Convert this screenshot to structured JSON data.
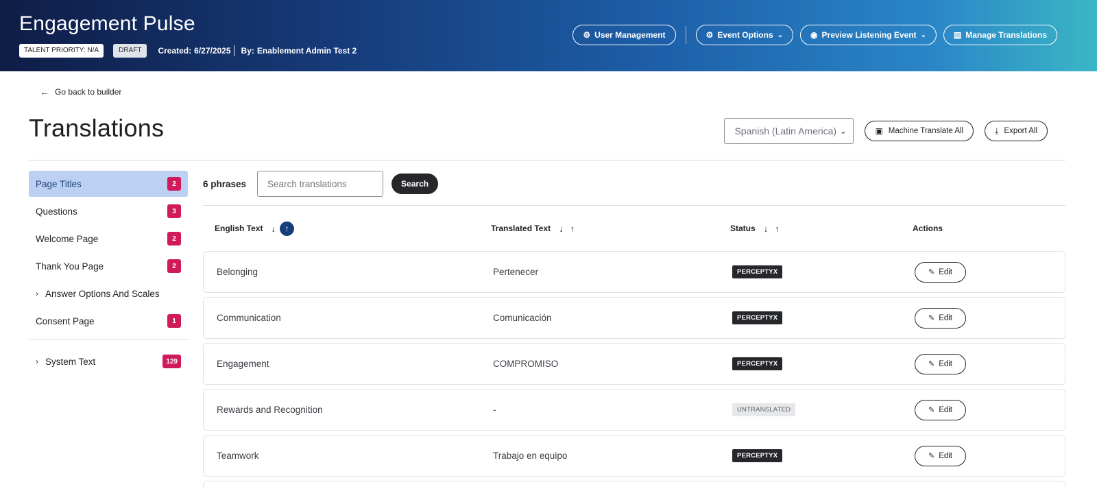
{
  "header": {
    "title": "Engagement Pulse",
    "talent_priority": "TALENT PRIORITY: N/A",
    "draft_label": "DRAFT",
    "created_label": "Created:",
    "created_value": "6/27/2025",
    "by_label": "By:",
    "by_value": "Enablement Admin Test 2",
    "actions": {
      "user_management": "User Management",
      "event_options": "Event Options",
      "preview_event": "Preview Listening Event",
      "manage_translations": "Manage Translations"
    }
  },
  "back_link": "Go back to builder",
  "page_title": "Translations",
  "controls": {
    "language_selected": "Spanish (Latin America)",
    "machine_translate": "Machine Translate All",
    "export_all": "Export All"
  },
  "sidebar": {
    "items": [
      {
        "label": "Page Titles",
        "count": "2"
      },
      {
        "label": "Questions",
        "count": "3"
      },
      {
        "label": "Welcome Page",
        "count": "2"
      },
      {
        "label": "Thank You Page",
        "count": "2"
      },
      {
        "label": "Answer Options And Scales"
      },
      {
        "label": "Consent Page",
        "count": "1"
      },
      {
        "label": "System Text",
        "count": "129"
      }
    ]
  },
  "main": {
    "phrase_count": "6 phrases",
    "search_placeholder": "Search translations",
    "search_button": "Search",
    "columns": {
      "english": "English Text",
      "translated": "Translated Text",
      "status": "Status",
      "actions": "Actions"
    },
    "rows": [
      {
        "english": "Belonging",
        "translated": "Pertenecer",
        "status": "PERCEPTYX",
        "action": "Edit"
      },
      {
        "english": "Communication",
        "translated": "Comunicación",
        "status": "PERCEPTYX",
        "action": "Edit"
      },
      {
        "english": "Engagement",
        "translated": "COMPROMISO",
        "status": "PERCEPTYX",
        "action": "Edit"
      },
      {
        "english": "Rewards and Recognition",
        "translated": "-",
        "status": "UNTRANSLATED",
        "action": "Edit"
      },
      {
        "english": "Teamwork",
        "translated": "Trabajo en equipo",
        "status": "PERCEPTYX",
        "action": "Edit"
      }
    ]
  },
  "colors": {
    "accent_badge": "#d11a5c",
    "active_sidebar": "#bcd0f2",
    "dark_button": "#26272b",
    "sort_active": "#163e7a"
  }
}
